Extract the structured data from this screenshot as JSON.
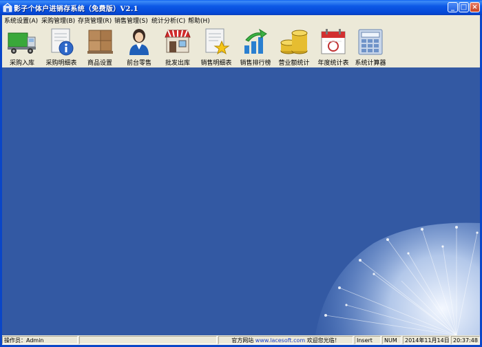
{
  "window": {
    "title": "影子个体户进销存系统（免费版）V2.1",
    "buttons": {
      "minimize": "_",
      "maximize": "□",
      "close": "×"
    }
  },
  "menu": [
    {
      "label": "系统设置(A)"
    },
    {
      "label": "采购管理(B)"
    },
    {
      "label": "存货管理(R)"
    },
    {
      "label": "销售管理(S)"
    },
    {
      "label": "统计分析(C)"
    },
    {
      "label": "帮助(H)"
    }
  ],
  "toolbar": [
    {
      "label": "采购入库",
      "icon": "truck-icon"
    },
    {
      "label": "采购明细表",
      "icon": "info-document-icon"
    },
    {
      "label": "商品设置",
      "icon": "boxes-icon"
    },
    {
      "label": "前台零售",
      "icon": "cashier-person-icon"
    },
    {
      "label": "批发出库",
      "icon": "store-icon"
    },
    {
      "label": "销售明细表",
      "icon": "star-document-icon"
    },
    {
      "label": "销售排行榜",
      "icon": "bar-chart-arrow-icon"
    },
    {
      "label": "营业额统计",
      "icon": "coins-icon"
    },
    {
      "label": "年度统计表",
      "icon": "calendar-icon"
    },
    {
      "label": "系统计算器",
      "icon": "calculator-icon"
    }
  ],
  "status": {
    "operator": "操作员：Admin",
    "site_label": "官方网站",
    "site_url": "www.lacesoft.com",
    "welcome": "欢迎您光临！",
    "mode": "Insert",
    "num": "NUM",
    "date": "2014年11月14日",
    "time": "20:37:48 ..."
  },
  "colors": {
    "titlebar": "#0a59e6",
    "background": "#3359a3",
    "chrome": "#ece9d8"
  }
}
